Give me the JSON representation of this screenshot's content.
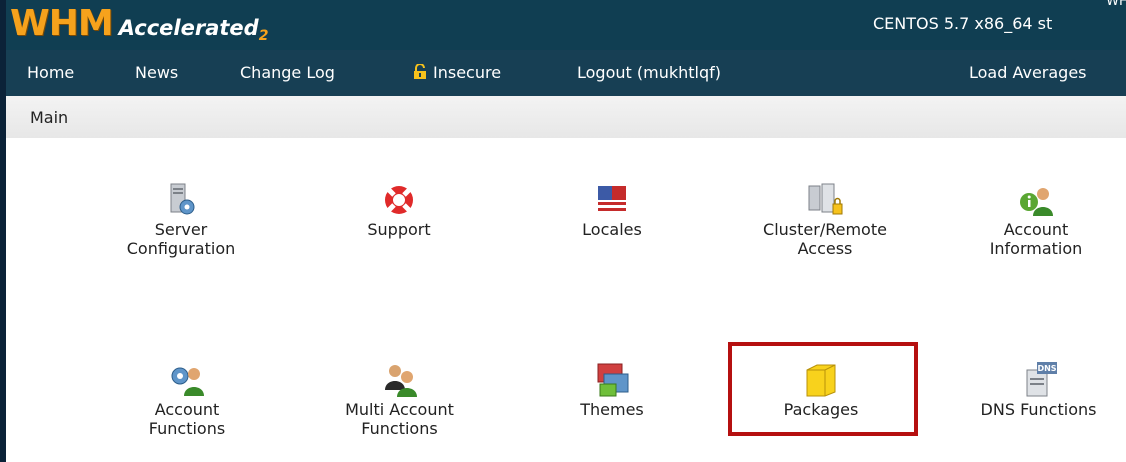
{
  "header": {
    "logo_main": "WHM",
    "logo_accel": "Accelerated",
    "logo_sub": "2",
    "server_top": "WHM",
    "server_os": "CENTOS 5.7 x86_64 st"
  },
  "nav": {
    "items": [
      {
        "label": "Home"
      },
      {
        "label": "News"
      },
      {
        "label": "Change Log"
      },
      {
        "label": "Insecure"
      },
      {
        "label": "Logout (mukhtlqf)"
      },
      {
        "label": "Load Averages"
      }
    ]
  },
  "breadcrumb": {
    "label": "Main"
  },
  "tiles": [
    {
      "label": "Server\nConfiguration",
      "icon": "server-config-icon"
    },
    {
      "label": "Support",
      "icon": "lifebuoy-icon"
    },
    {
      "label": "Locales",
      "icon": "flag-icon"
    },
    {
      "label": "Cluster/Remote\nAccess",
      "icon": "cluster-icon"
    },
    {
      "label": "Account\nInformation",
      "icon": "account-info-icon"
    },
    {
      "label": "Account\nFunctions",
      "icon": "account-gear-icon"
    },
    {
      "label": "Multi Account\nFunctions",
      "icon": "multi-account-icon"
    },
    {
      "label": "Themes",
      "icon": "themes-icon"
    },
    {
      "label": "Packages",
      "icon": "package-box-icon"
    },
    {
      "label": "DNS Functions",
      "icon": "dns-icon"
    }
  ],
  "colors": {
    "header_bg": "#103e52",
    "logo_orange": "#f6a21c",
    "highlight": "#b51010"
  }
}
